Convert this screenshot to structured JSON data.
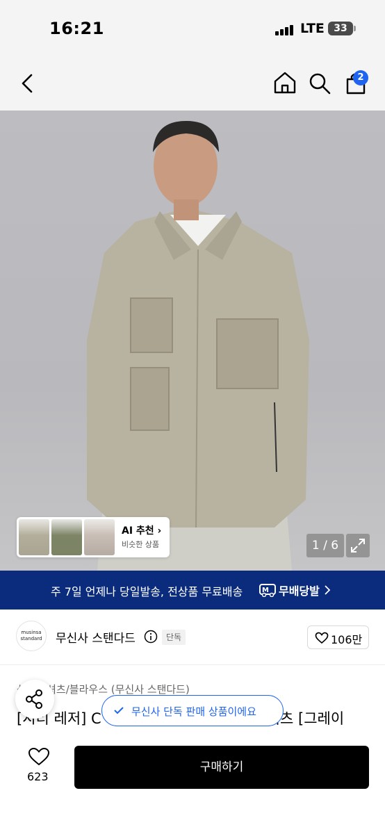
{
  "status_bar": {
    "time": "16:21",
    "network": "LTE",
    "battery": "33"
  },
  "top_nav": {
    "icons": [
      "back-icon",
      "home-icon",
      "search-icon",
      "cart-icon"
    ],
    "cart_count": "2"
  },
  "gallery": {
    "ai_recommend_label": "AI 추천",
    "ai_recommend_sub": "비슷한 상품",
    "page_indicator": "1 / 6"
  },
  "banner": {
    "text": "주 7일 언제나 당일발송, 전상품 무료배송",
    "brand": "무배당발",
    "background_color": "#0b2c7d"
  },
  "brand": {
    "logo_text": "musinsa standard",
    "name": "무신사 스탠다드",
    "tag": "단독",
    "like_count": "106만"
  },
  "product": {
    "category": "상의 › 셔츠/블라우스 (무신사 스탠다드)",
    "title_line1": "[시티 레저] C",
    "title_line2": "셔츠 [그레이"
  },
  "toast": {
    "text": "무신사 단독 판매 상품이에요",
    "color": "#1e64f0"
  },
  "bottom_bar": {
    "wish_count": "623",
    "buy_label": "구매하기"
  }
}
